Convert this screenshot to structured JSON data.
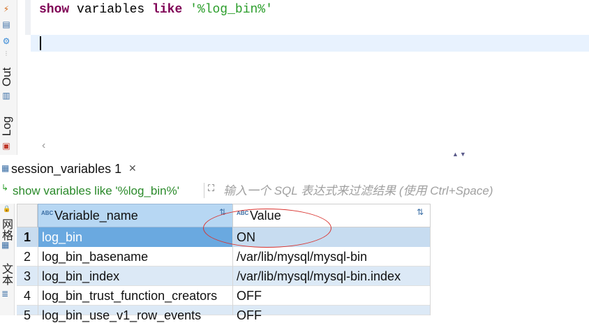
{
  "editor": {
    "sql": {
      "kw1": "show",
      "mid": " variables ",
      "kw2": "like",
      "space": " ",
      "str": "'%log_bin%'"
    },
    "scroll_left_glyph": "‹",
    "split_arrows": "▲▼"
  },
  "left_panel": {
    "out_label": "Out",
    "log_label": "Log"
  },
  "results": {
    "tab_label": "session_variables 1",
    "tab_close": "✕",
    "filter_sql": "show variables like '%log_bin%'",
    "filter_placeholder": "输入一个 SQL 表达式来过滤结果 (使用 Ctrl+Space)",
    "left_labels": {
      "grid": "网格",
      "text": "文本"
    },
    "columns": [
      {
        "type_badge": "ABC",
        "label": "Variable_name"
      },
      {
        "type_badge": "ABC",
        "label": "Value"
      }
    ],
    "rows": [
      {
        "num": "1",
        "name": "log_bin",
        "value": "ON"
      },
      {
        "num": "2",
        "name": "log_bin_basename",
        "value": "/var/lib/mysql/mysql-bin"
      },
      {
        "num": "3",
        "name": "log_bin_index",
        "value": "/var/lib/mysql/mysql-bin.index"
      },
      {
        "num": "4",
        "name": "log_bin_trust_function_creators",
        "value": "OFF"
      },
      {
        "num": "5",
        "name": "log_bin_use_v1_row_events",
        "value": "OFF"
      }
    ]
  },
  "colors": {
    "keyword": "#7f0055",
    "string": "#2a9d2a",
    "header_bg": "#b7d7f3",
    "selected_row": "#6aa9e0",
    "alt_row": "#dce9f6",
    "annotation": "#d9322e"
  }
}
